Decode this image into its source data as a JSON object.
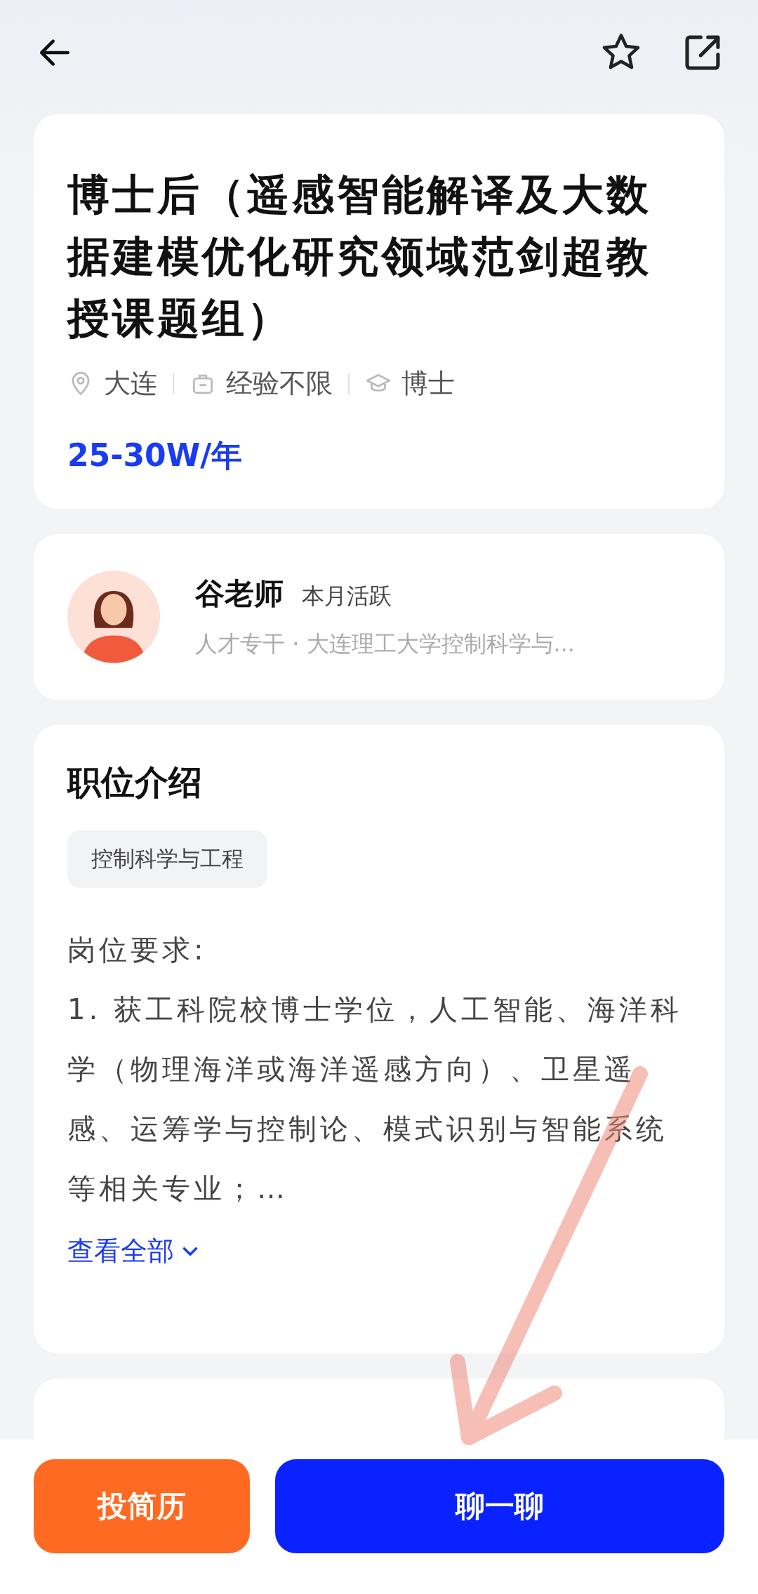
{
  "top_bar": {
    "favorited": false
  },
  "job": {
    "title": "博士后（遥感智能解译及大数据建模优化研究领域范剑超教授课题组）",
    "meta": [
      {
        "kind": "location",
        "text": "大连"
      },
      {
        "kind": "experience",
        "text": "经验不限"
      },
      {
        "kind": "education",
        "text": "博士"
      }
    ],
    "salary": "25-30W/年"
  },
  "recruiter": {
    "name": "谷老师",
    "status": "本月活跃",
    "description": "人才专干 · 大连理工大学控制科学与..."
  },
  "position": {
    "heading": "职位介绍",
    "tags": [
      "控制科学与工程"
    ],
    "requirements_heading": "岗位要求:",
    "requirements": "1. 获工科院校博士学位，人工智能、海洋科学（物理海洋或海洋遥感方向）、卫星遥感、运筹学与控制论、模式识别与智能系统等相关专业；…",
    "more_link": "查看全部"
  },
  "actions": [
    {
      "kind": "secondary",
      "label": "投简历"
    },
    {
      "kind": "primary",
      "label": "聊一聊"
    }
  ]
}
